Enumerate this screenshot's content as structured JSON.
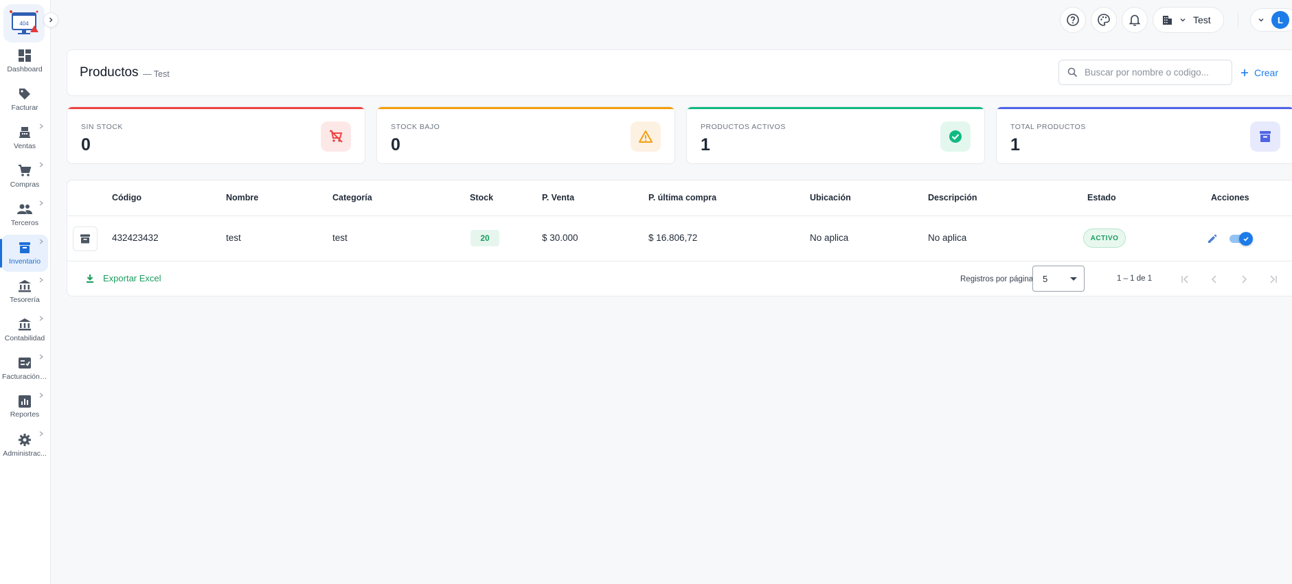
{
  "sidebar": {
    "items": [
      {
        "label": "Dashboard",
        "icon": "dashboard-icon",
        "has_submenu": false
      },
      {
        "label": "Facturar",
        "icon": "tag-icon",
        "has_submenu": false
      },
      {
        "label": "Ventas",
        "icon": "cash-register-icon",
        "has_submenu": true
      },
      {
        "label": "Compras",
        "icon": "cart-icon",
        "has_submenu": true
      },
      {
        "label": "Terceros",
        "icon": "people-icon",
        "has_submenu": true
      },
      {
        "label": "Inventario",
        "icon": "archive-box-icon",
        "has_submenu": true,
        "active": true
      },
      {
        "label": "Tesorería",
        "icon": "bank-icon",
        "has_submenu": true
      },
      {
        "label": "Contabilidad",
        "icon": "bank-icon",
        "has_submenu": true
      },
      {
        "label": "Facturación ...",
        "icon": "checklist-icon",
        "has_submenu": true
      },
      {
        "label": "Reportes",
        "icon": "bar-chart-icon",
        "has_submenu": true
      },
      {
        "label": "Administrac...",
        "icon": "gear-icon",
        "has_submenu": true
      }
    ]
  },
  "topbar": {
    "company": "Test",
    "avatar_initial": "L"
  },
  "header": {
    "title": "Productos",
    "subtitle": "— Test",
    "search_placeholder": "Buscar por nombre o codigo...",
    "create_label": "Crear"
  },
  "stats": [
    {
      "label": "SIN STOCK",
      "value": "0",
      "color": "#ef4444",
      "icon_bg": "#fde8e8",
      "icon": "cart-off-icon"
    },
    {
      "label": "STOCK BAJO",
      "value": "0",
      "color": "#f59e0b",
      "icon_bg": "#fdf1e2",
      "icon": "warning-icon"
    },
    {
      "label": "PRODUCTOS ACTIVOS",
      "value": "1",
      "color": "#10b981",
      "icon_bg": "#e3f7ee",
      "icon": "check-circle-icon"
    },
    {
      "label": "TOTAL PRODUCTOS",
      "value": "1",
      "color": "#4f63e6",
      "icon_bg": "#e7eafc",
      "icon": "archive-box-icon"
    }
  ],
  "table": {
    "columns": [
      "Código",
      "Nombre",
      "Categoría",
      "Stock",
      "P. Venta",
      "P. última compra",
      "Ubicación",
      "Descripción",
      "Estado",
      "Acciones"
    ],
    "rows": [
      {
        "codigo": "432423432",
        "nombre": "test",
        "categoria": "test",
        "stock": "20",
        "p_venta": "$ 30.000",
        "p_ultima_compra": "$ 16.806,72",
        "ubicacion": "No aplica",
        "descripcion": "No aplica",
        "estado": "ACTIVO",
        "enabled": true
      }
    ]
  },
  "footer": {
    "export_label": "Exportar Excel",
    "rows_per_page_label": "Registros por página",
    "rows_per_page_value": "5",
    "range_text": "1 – 1 de 1"
  },
  "colors": {
    "accent": "#1d7ce8",
    "success": "#1a9c5e"
  }
}
